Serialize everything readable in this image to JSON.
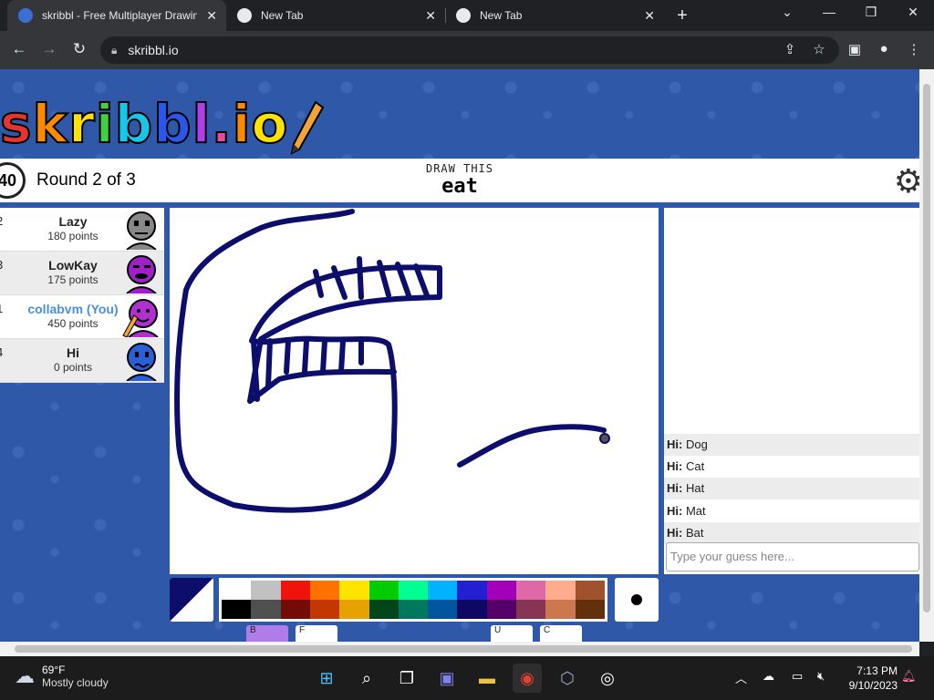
{
  "browser": {
    "tabs": [
      {
        "title": "skribbl - Free Multiplayer Drawin",
        "active": true
      },
      {
        "title": "New Tab",
        "active": false
      },
      {
        "title": "New Tab",
        "active": false
      }
    ],
    "new_tab_symbol": "+",
    "url": "skribbl.io"
  },
  "game": {
    "logo": "skribbl.io",
    "timer": "40",
    "round_text": "Round 2 of 3",
    "draw_label": "DRAW THIS",
    "word": "eat",
    "players": [
      {
        "rank": "2",
        "name": "Lazy",
        "points": "180 points",
        "color": "#888888",
        "you": false
      },
      {
        "rank": "3",
        "name": "LowKay",
        "points": "175 points",
        "color": "#a020c8",
        "you": false
      },
      {
        "rank": "1",
        "name": "collabvm (You)",
        "points": "450 points",
        "color": "#b030d0",
        "you": true
      },
      {
        "rank": "4",
        "name": "Hi",
        "points": "0 points",
        "color": "#2a5fd8",
        "you": false
      }
    ],
    "chat": [
      {
        "user": "Hi:",
        "text": "Dog"
      },
      {
        "user": "Hi:",
        "text": "Cat"
      },
      {
        "user": "Hi:",
        "text": "Hat"
      },
      {
        "user": "Hi:",
        "text": "Mat"
      },
      {
        "user": "Hi:",
        "text": "Bat"
      }
    ],
    "guess_placeholder": "Type your guess here...",
    "current_color": "#0d0d6b",
    "palette_top": [
      "#ffffff",
      "#c1c1c1",
      "#ef130b",
      "#ff7100",
      "#ffe400",
      "#00cc00",
      "#00ff91",
      "#00b2ff",
      "#231fd3",
      "#a300ba",
      "#df69a7",
      "#ffac8e",
      "#a0522d"
    ],
    "palette_bottom": [
      "#000000",
      "#505050",
      "#740b07",
      "#c23800",
      "#e8a200",
      "#004619",
      "#00785d",
      "#00569e",
      "#0e0865",
      "#550069",
      "#873554",
      "#cc774d",
      "#63300d"
    ],
    "tool_buttons": [
      "B",
      "F",
      "U",
      "C"
    ]
  },
  "taskbar": {
    "temperature": "69°F",
    "weather": "Mostly cloudy",
    "time": "7:13 PM",
    "date": "9/10/2023"
  }
}
